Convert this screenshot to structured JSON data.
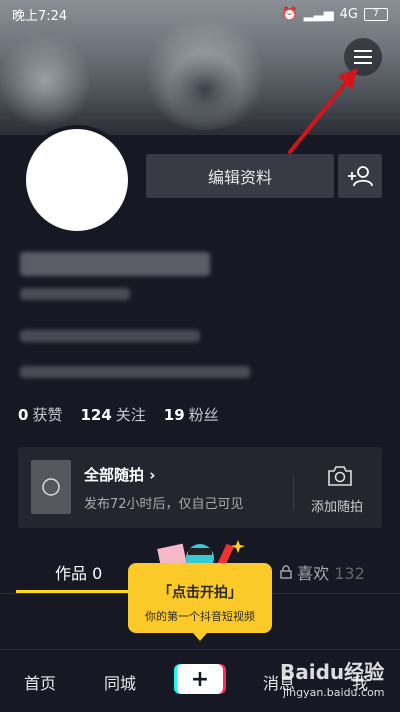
{
  "status_bar": {
    "time": "晚上7:24",
    "network": "4G",
    "battery": "7"
  },
  "profile": {
    "edit_label": "编辑资料"
  },
  "stats": [
    {
      "value": "0",
      "label": "获赞"
    },
    {
      "value": "124",
      "label": "关注"
    },
    {
      "value": "19",
      "label": "粉丝"
    }
  ],
  "card": {
    "title": "全部随拍",
    "title_arrow": "›",
    "subtitle": "发布72小时后，仅自己可见",
    "action_label": "添加随拍"
  },
  "tabs": {
    "works": "作品 0",
    "likes": "喜欢",
    "likes_count": "132"
  },
  "tooltip": {
    "title": "「点击开拍」",
    "subtitle": "你的第一个抖音短视频"
  },
  "bottom_nav": {
    "home": "首页",
    "local": "同城",
    "plus": "+",
    "messages": "消息",
    "me": "我"
  },
  "watermark": {
    "brand": "Baidu经验",
    "url": "jingyan.baidu.com"
  },
  "colors": {
    "accent": "#ffd91a",
    "annotation_arrow": "#d0161c",
    "tooltip": "#fbc928",
    "background": "#161823"
  }
}
